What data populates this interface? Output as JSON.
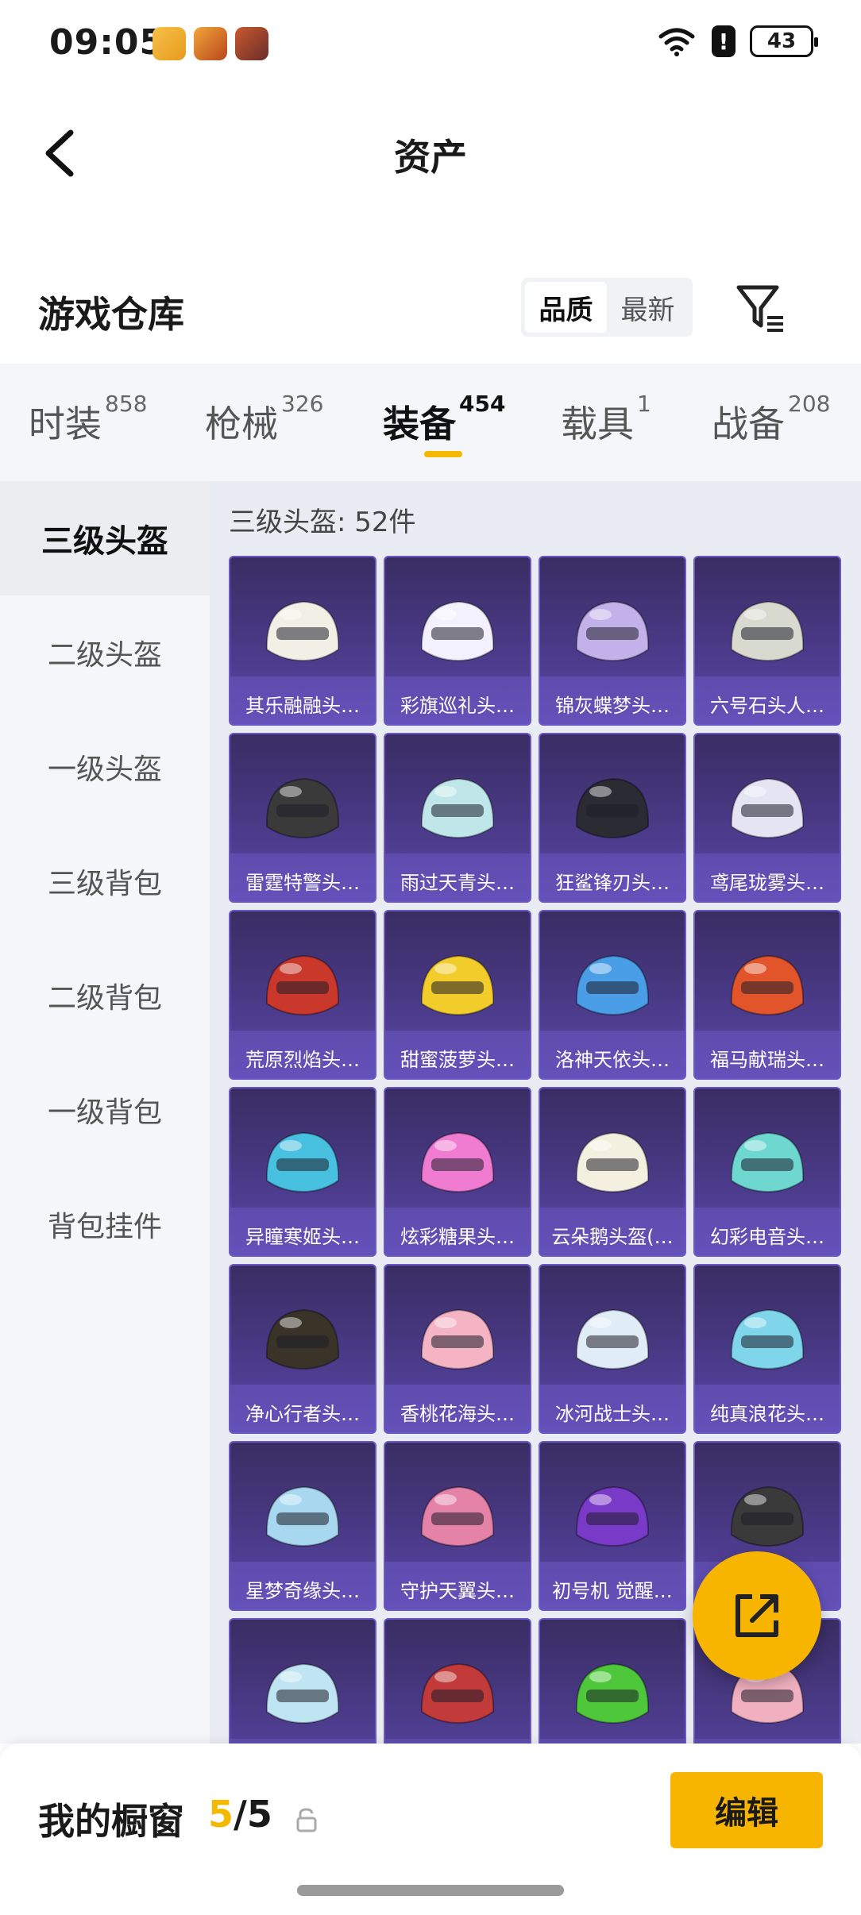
{
  "status_bar": {
    "time": "09:05",
    "battery": "43"
  },
  "nav": {
    "title": "资产"
  },
  "header": {
    "title": "游戏仓库",
    "sort_options": [
      "品质",
      "最新"
    ],
    "active_sort": 0
  },
  "tabs": [
    {
      "label": "时装",
      "count": "858"
    },
    {
      "label": "枪械",
      "count": "326"
    },
    {
      "label": "装备",
      "count": "454"
    },
    {
      "label": "载具",
      "count": "1"
    },
    {
      "label": "战备",
      "count": "208"
    }
  ],
  "active_tab": 2,
  "sidebar": {
    "items": [
      "三级头盔",
      "二级头盔",
      "一级头盔",
      "三级背包",
      "二级背包",
      "一级背包",
      "背包挂件"
    ],
    "active": 0
  },
  "grid": {
    "caption": "三级头盔: 52件",
    "items": [
      {
        "label": "其乐融融头…",
        "color": "#f2efe6"
      },
      {
        "label": "彩旗巡礼头…",
        "color": "#f4f1ff"
      },
      {
        "label": "锦灰蝶梦头…",
        "color": "#c3b2ea"
      },
      {
        "label": "六号石头人…",
        "color": "#d8d9cf"
      },
      {
        "label": "雷霆特警头…",
        "color": "#3a3a3a"
      },
      {
        "label": "雨过天青头…",
        "color": "#bfe7ea"
      },
      {
        "label": "狂鲨锋刃头…",
        "color": "#2b2b33"
      },
      {
        "label": "鸢尾珑雾头…",
        "color": "#e4e4f2"
      },
      {
        "label": "荒原烈焰头…",
        "color": "#c9382a"
      },
      {
        "label": "甜蜜菠萝头…",
        "color": "#f2cc2a"
      },
      {
        "label": "洛神天依头…",
        "color": "#4a9ee8"
      },
      {
        "label": "福马献瑞头…",
        "color": "#e2542a"
      },
      {
        "label": "异瞳寒姬头…",
        "color": "#48c0e0"
      },
      {
        "label": "炫彩糖果头…",
        "color": "#f07cd2"
      },
      {
        "label": "云朵鹅头盔(…",
        "color": "#f4f0e0"
      },
      {
        "label": "幻彩电音头…",
        "color": "#6ed8d0"
      },
      {
        "label": "净心行者头…",
        "color": "#3a3328"
      },
      {
        "label": "香桃花海头…",
        "color": "#f4b4c4"
      },
      {
        "label": "冰河战士头…",
        "color": "#e0ecf6"
      },
      {
        "label": "纯真浪花头…",
        "color": "#7fd6ea"
      },
      {
        "label": "星梦奇缘头…",
        "color": "#a7d8f0"
      },
      {
        "label": "守护天翼头…",
        "color": "#e482a8"
      },
      {
        "label": "初号机 觉醒…",
        "color": "#7a3ac8"
      },
      {
        "label": "",
        "color": "#3a3a3a"
      },
      {
        "label": "",
        "color": "#bfe4f2"
      },
      {
        "label": "",
        "color": "#c23a3a"
      },
      {
        "label": "",
        "color": "#4ec83a"
      },
      {
        "label": "",
        "color": "#f0b0c0"
      }
    ]
  },
  "bottom": {
    "label": "我的橱窗",
    "current": "5",
    "separator": "/",
    "total": "5",
    "edit_label": "编辑"
  }
}
